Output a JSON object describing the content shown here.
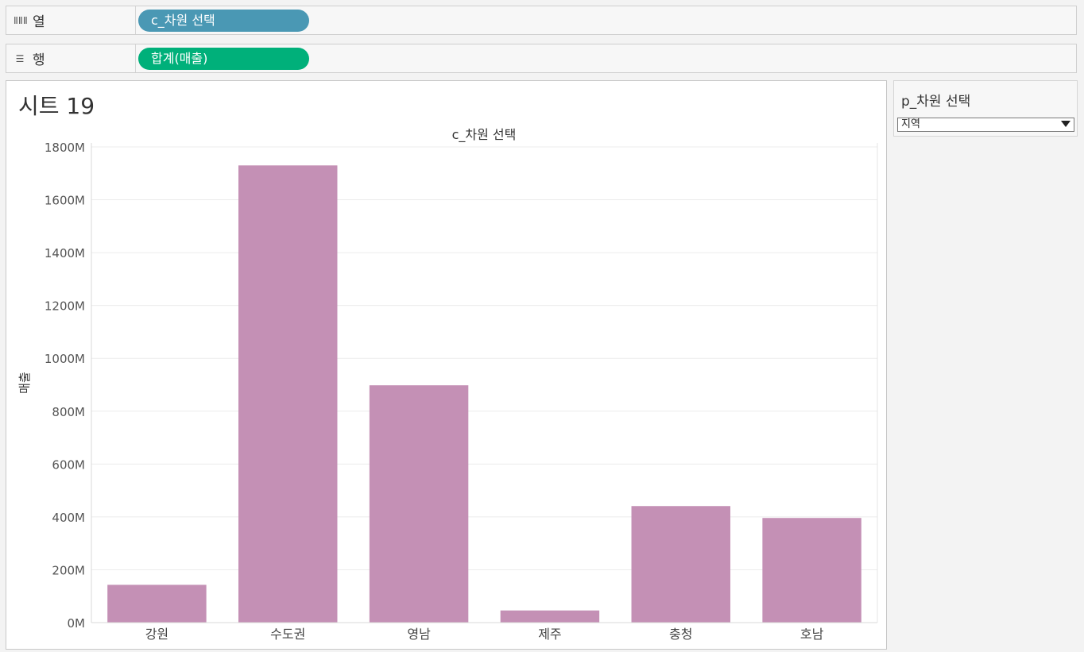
{
  "columns_shelf": {
    "label": "열",
    "icon": "columns-icon",
    "pill": "c_차원 선택",
    "pill_color": "#4a98b4"
  },
  "rows_shelf": {
    "label": "행",
    "icon": "rows-icon",
    "pill": "합계(매출)",
    "pill_color": "#00b07a"
  },
  "sheet": {
    "title": "시트 19"
  },
  "parameter": {
    "title": "p_차원 선택",
    "selected": "지역"
  },
  "chart_data": {
    "type": "bar",
    "title": "c_차원 선택",
    "xlabel": "",
    "ylabel": "매출",
    "categories": [
      "강원",
      "수도권",
      "영남",
      "제주",
      "충청",
      "호남"
    ],
    "values": [
      143,
      1730,
      898,
      46,
      441,
      396
    ],
    "value_unit_suffix": "M",
    "ylim": [
      0,
      1800
    ],
    "yticks": [
      0,
      200,
      400,
      600,
      800,
      1000,
      1200,
      1400,
      1600,
      1800
    ],
    "ytick_labels": [
      "0M",
      "200M",
      "400M",
      "600M",
      "800M",
      "1000M",
      "1200M",
      "1400M",
      "1600M",
      "1800M"
    ],
    "bar_color": "#c490b5",
    "grid": true
  }
}
